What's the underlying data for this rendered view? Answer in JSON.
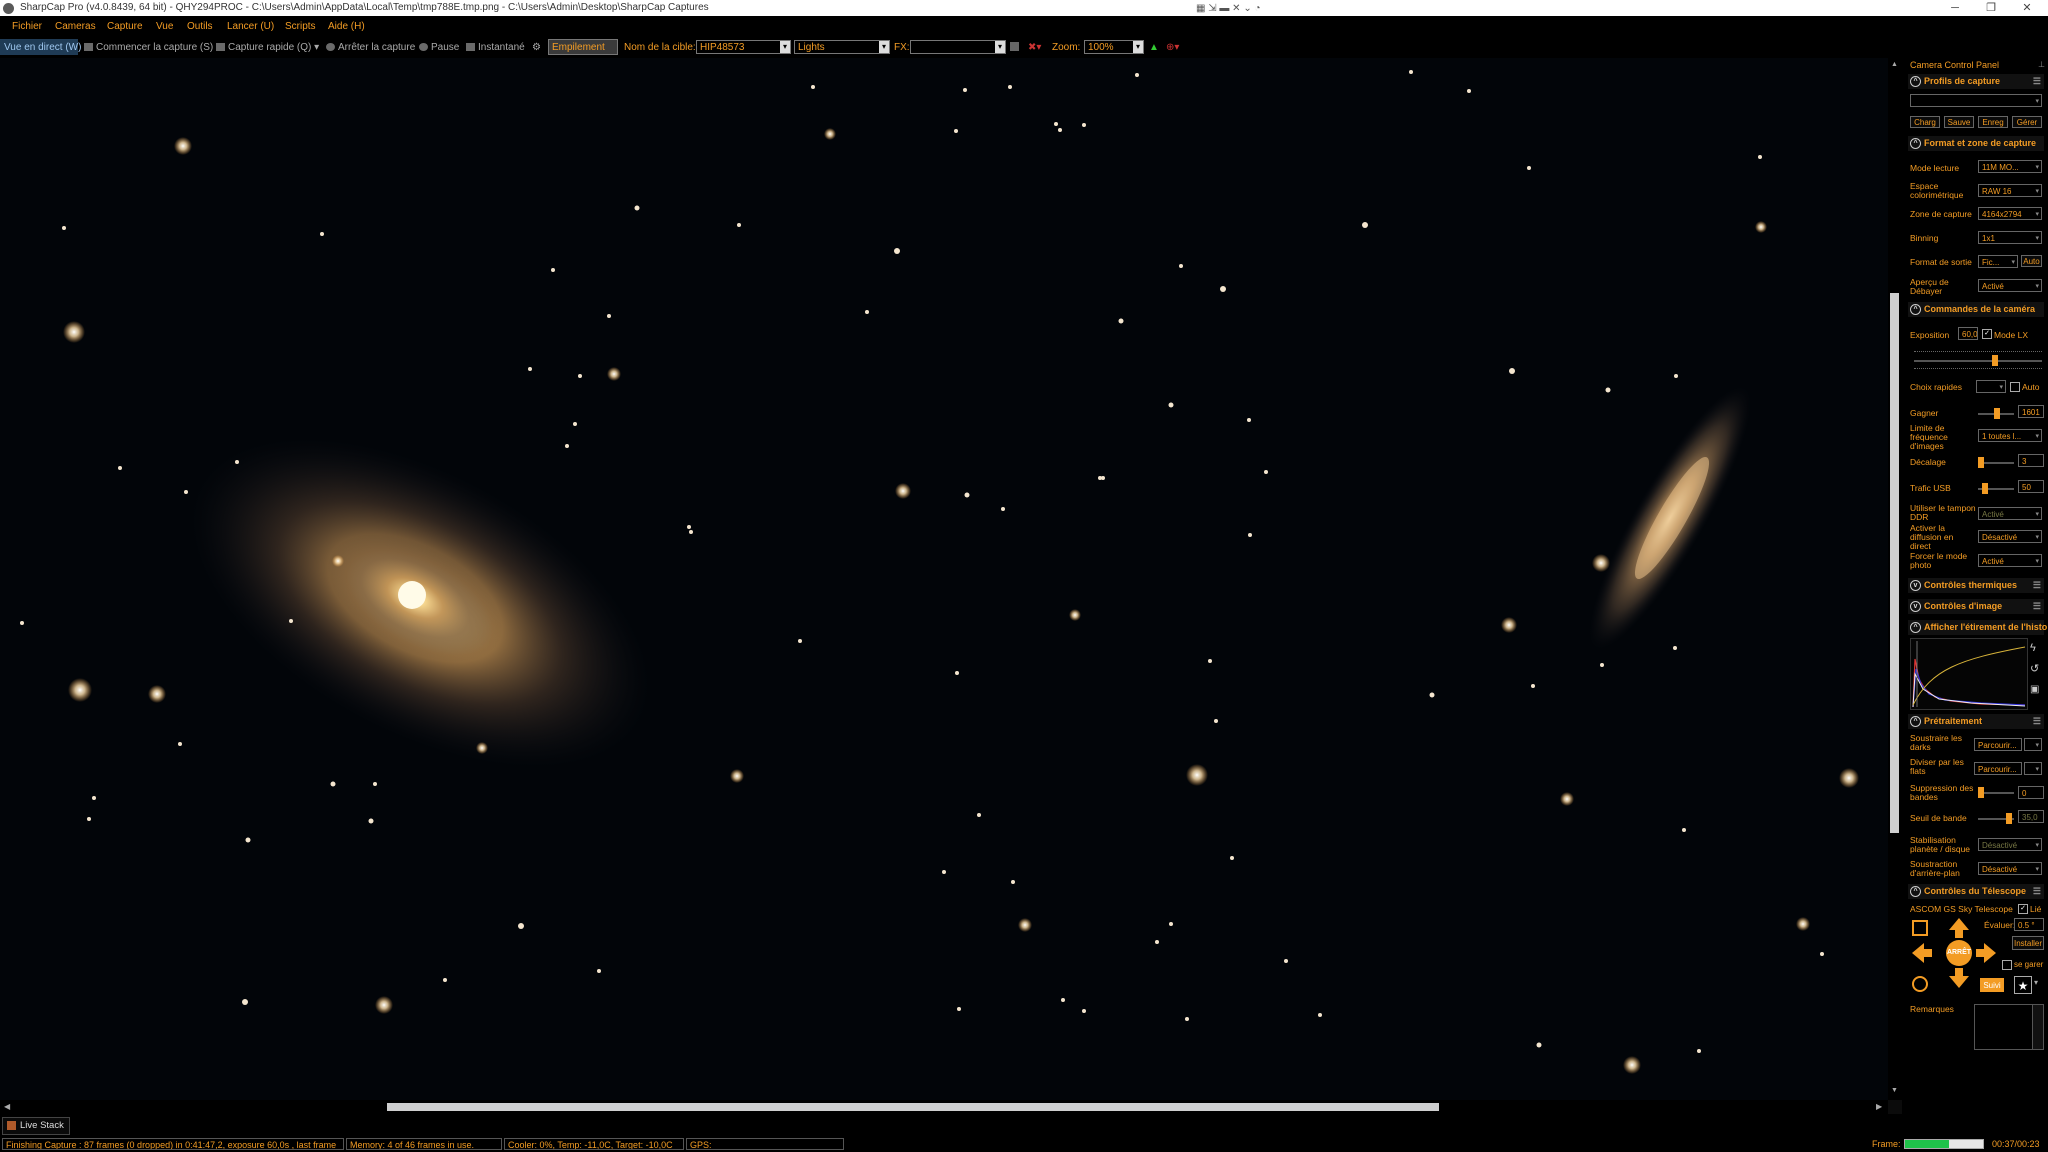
{
  "window": {
    "title": "SharpCap Pro (v4.0.8439, 64 bit) - QHY294PROC - C:\\Users\\Admin\\AppData\\Local\\Temp\\tmp788E.tmp.png - C:\\Users\\Admin\\Desktop\\SharpCap Captures"
  },
  "menu": [
    "Fichier",
    "Cameras",
    "Capture",
    "Vue",
    "Outils",
    "Lancer (U)",
    "Scripts",
    "Aide (H)"
  ],
  "toolbar": {
    "live_view": "Vue en direct (W)",
    "start_capture": "Commencer la capture (S)",
    "quick_capture": "Capture rapide (Q)",
    "stop_capture": "Arrêter la capture",
    "pause": "Pause",
    "snapshot": "Instantané",
    "stack": "Empilement",
    "target_label": "Nom de la cible:",
    "target_value": "HIP48573",
    "frame_type": "Lights",
    "fx_label": "FX:",
    "fx_value": "",
    "zoom_label": "Zoom:",
    "zoom_value": "100%"
  },
  "panel": {
    "title": "Camera Control Panel",
    "profiles": {
      "header": "Profils de capture",
      "select": "",
      "buttons": [
        "Charg",
        "Sauve",
        "Enreg",
        "Gérer"
      ]
    },
    "format": {
      "header": "Format et zone de capture",
      "rows": [
        {
          "label": "Mode lecture",
          "value": "11M MO..."
        },
        {
          "label": "Espace colorimétrique",
          "value": "RAW 16"
        },
        {
          "label": "Zone de capture",
          "value": "4164x2794"
        },
        {
          "label": "Binning",
          "value": "1x1"
        },
        {
          "label": "Format de sortie",
          "value": "Fic...",
          "extra": "Auto"
        },
        {
          "label": "Aperçu de Débayer",
          "value": "Activé"
        }
      ]
    },
    "camera": {
      "header": "Commandes de la caméra",
      "exposure_label": "Exposition",
      "exposure_value": "60,0",
      "lx_label": "Mode LX",
      "quick_label": "Choix rapides",
      "quick_auto": "Auto",
      "gain_label": "Gagner",
      "gain_value": "1601",
      "fps_label": "Limite de fréquence d'images",
      "fps_value": "1 toutes l...",
      "offset_label": "Décalage",
      "offset_value": "3",
      "usb_label": "Trafic USB",
      "usb_value": "50",
      "ddr_label": "Utiliser le tampon DDR",
      "ddr_value": "Activé",
      "diffusion_label": "Activer la diffusion en direct",
      "diffusion_value": "Désactivé",
      "photo_label": "Forcer le mode photo",
      "photo_value": "Activé"
    },
    "thermal": {
      "header": "Contrôles thermiques"
    },
    "image": {
      "header": "Contrôles d'image"
    },
    "histogram": {
      "header": "Afficher l'étirement de l'histo"
    },
    "preprocess": {
      "header": "Prétraitement",
      "darks_label": "Soustraire les darks",
      "darks_value": "Parcourir...",
      "flats_label": "Diviser par les flats",
      "flats_value": "Parcourir...",
      "banding_label": "Suppression des bandes",
      "banding_value": "0",
      "threshold_label": "Seuil de bande",
      "threshold_value": "35,0",
      "stab_label": "Stabilisation planète / disque",
      "stab_value": "Désactivé",
      "bg_label": "Soustraction d'arrière-plan",
      "bg_value": "Désactivé"
    },
    "telescope": {
      "header": "Contrôles du Télescope",
      "mount": "ASCOM GS Sky Telescope",
      "linked": "Lié",
      "rate_label": "Évaluer:",
      "rate_value": "0.5 °",
      "install": "Installer",
      "park": "se garer",
      "stop": "ARRÊT",
      "track": "Suivi"
    },
    "notes_label": "Remarques"
  },
  "live_stack_tab": "Live Stack",
  "status": {
    "capture": "Finishing Capture : 87 frames (0 dropped) in 0:41:47,2, exposure 60,0s , last frame",
    "memory": "Memory: 4 of 46 frames in use.",
    "cooler": "Cooler: 0%, Temp: -11,0C, Target: -10,0C",
    "gps": "GPS:",
    "frame_label": "Frame:",
    "elapsed": "00:37/00:23"
  },
  "colors": {
    "accent": "#f39c24",
    "background": "#000000",
    "sky": "#020509"
  }
}
